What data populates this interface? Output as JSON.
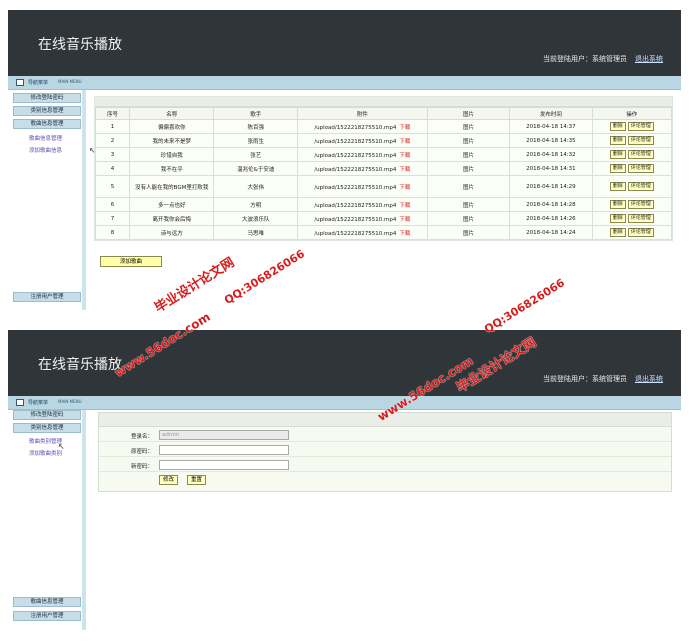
{
  "app_title": "在线音乐播放",
  "current_user": "当前登陆用户：系统管理员",
  "logout": "退出系统",
  "menu_title": "导航菜单",
  "menu_en": "MAIN MENU",
  "p1": {
    "sidebar": [
      "修改登陆密码",
      "类别信息管理",
      "歌曲信息管理"
    ],
    "sub_links": [
      "歌曲信息管理",
      "添加歌曲信息"
    ],
    "bottom_btn": "注册用户管理",
    "columns": [
      "序号",
      "名称",
      "歌手",
      "附件",
      "图片",
      "发布时间",
      "操作"
    ],
    "download": "下载",
    "delete": "删除",
    "comment": "评论管理",
    "rows": [
      {
        "no": "1",
        "name": "偏偏喜欢你",
        "singer": "陈百强",
        "file": "/upload/1522218275510.mp4",
        "img": "图片",
        "time": "2018-04-18 14:37"
      },
      {
        "no": "2",
        "name": "我的未来不是梦",
        "singer": "张雨生",
        "file": "/upload/1522218275510.mp4",
        "img": "图片",
        "time": "2018-04-18 14:35"
      },
      {
        "no": "3",
        "name": "珍惜自我",
        "singer": "张艺",
        "file": "/upload/1522218275510.mp4",
        "img": "图片",
        "time": "2018-04-18 14:32"
      },
      {
        "no": "4",
        "name": "我不在乎",
        "singer": "温兆伦&于安迪",
        "file": "/upload/1522218275510.mp4",
        "img": "图片",
        "time": "2018-04-18 14:31"
      },
      {
        "no": "5",
        "name": "没有人能在我的BGM里打败我",
        "singer": "大张伟",
        "file": "/upload/1522218275510.mp4",
        "img": "图片",
        "time": "2018-04-18 14:29"
      },
      {
        "no": "6",
        "name": "多一点也好",
        "singer": "方明",
        "file": "/upload/1522218275510.mp4",
        "img": "图片",
        "time": "2018-04-18 14:28"
      },
      {
        "no": "7",
        "name": "离开我你会后悔",
        "singer": "大波浪乐队",
        "file": "/upload/1522218275510.mp4",
        "img": "图片",
        "time": "2018-04-18 14:26"
      },
      {
        "no": "8",
        "name": "诗与远方",
        "singer": "马思唯",
        "file": "/upload/1522218275510.mp4",
        "img": "图片",
        "time": "2018-04-18 14:24"
      }
    ],
    "add_btn": "添加歌曲"
  },
  "p2": {
    "sidebar": [
      "修改登陆密码",
      "类别信息管理"
    ],
    "sub_links": [
      "歌曲类别管理",
      "添加歌曲类别"
    ],
    "bottom_btns": [
      "歌曲信息管理",
      "注册用户管理"
    ],
    "labels": [
      "登录名：",
      "原密码：",
      "新密码："
    ],
    "login_value": "admin",
    "submit": "修改",
    "reset": "重置"
  },
  "watermarks": {
    "site": "www.56doc.com",
    "qq": "QQ:306826066",
    "name": "毕业设计论文网"
  }
}
